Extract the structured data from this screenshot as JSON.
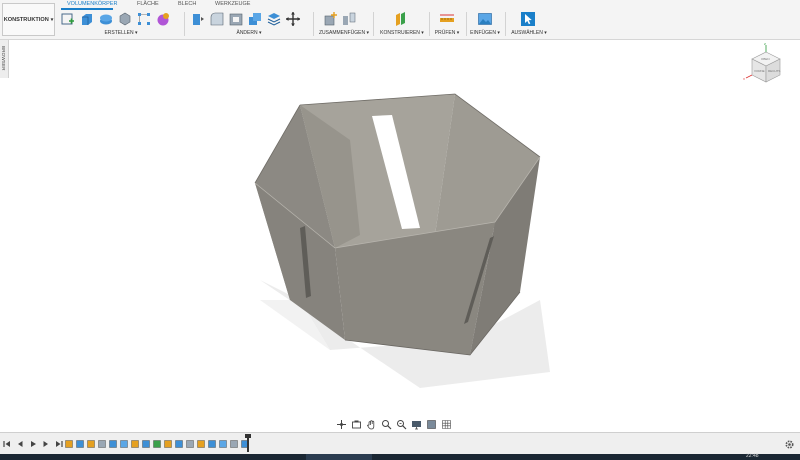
{
  "workspace": {
    "label": "KONSTRUKTION",
    "caret": "▾"
  },
  "tabs": [
    {
      "label": "VOLUMENKÖRPER",
      "active": true
    },
    {
      "label": "FLÄCHE",
      "active": false
    },
    {
      "label": "BLECH",
      "active": false
    },
    {
      "label": "WERKZEUGE",
      "active": false
    }
  ],
  "groups": {
    "erstellen": "ERSTELLEN ▾",
    "aendern": "ÄNDERN ▾",
    "zusammenfuegen": "ZUSAMMENFÜGEN ▾",
    "konstruieren": "KONSTRUIEREN ▾",
    "pruefen": "PRÜFEN ▾",
    "einfuegen": "EINFÜGEN ▾",
    "auswaehlen": "AUSWÄHLEN ▾"
  },
  "browser": {
    "label": "BROWSER"
  },
  "viewcube": {
    "top": "OBEN",
    "front": "VORNE",
    "right": "RECHTS",
    "axis_z": "Z",
    "axis_x": "X"
  },
  "colors": {
    "accent": "#1a7fc9",
    "model_body": "#8a8780",
    "model_inner": "#a09d95",
    "shadow": "#ececec"
  },
  "timeline": {
    "feature_count": 17
  },
  "taskbar": {
    "clock": "22:48"
  }
}
